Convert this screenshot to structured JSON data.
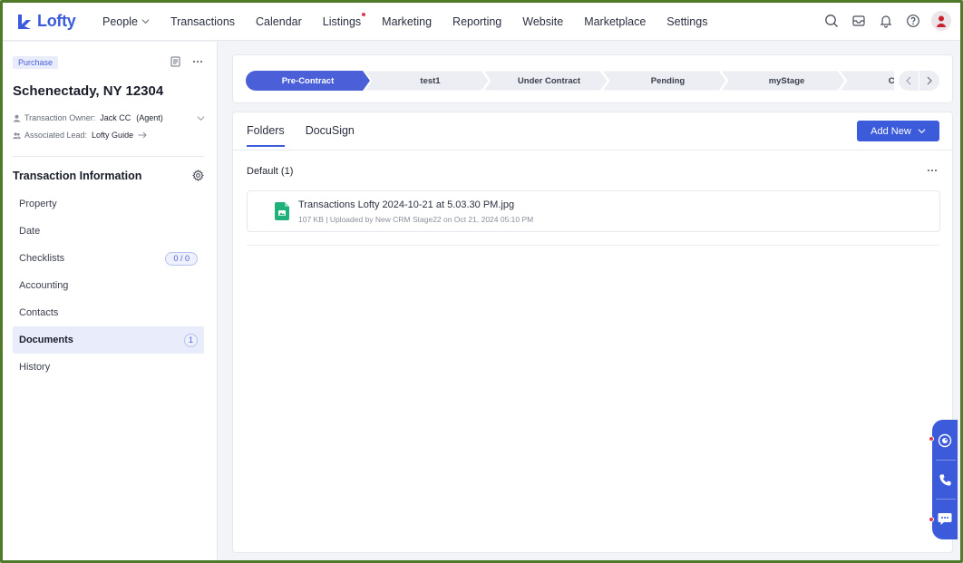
{
  "app": {
    "brand": "Lofty",
    "brand_color": "#3b5bdb"
  },
  "nav": {
    "items": [
      {
        "label": "People",
        "has_dropdown": true
      },
      {
        "label": "Transactions"
      },
      {
        "label": "Calendar"
      },
      {
        "label": "Listings",
        "has_dot": true
      },
      {
        "label": "Marketing"
      },
      {
        "label": "Reporting"
      },
      {
        "label": "Website"
      },
      {
        "label": "Marketplace"
      },
      {
        "label": "Settings"
      }
    ],
    "right_icons": [
      "search-icon",
      "inbox-icon",
      "bell-icon",
      "help-icon",
      "avatar"
    ]
  },
  "transaction": {
    "type_badge": "Purchase",
    "address": "Schenectady, NY 12304",
    "owner_label": "Transaction Owner:",
    "owner_name": "Jack CC",
    "owner_role": "(Agent)",
    "lead_label": "Associated Lead:",
    "lead_name": "Lofty Guide"
  },
  "sidebar": {
    "section_title": "Transaction Information",
    "items": [
      {
        "label": "Property"
      },
      {
        "label": "Date"
      },
      {
        "label": "Checklists",
        "badge": "0 / 0"
      },
      {
        "label": "Accounting"
      },
      {
        "label": "Contacts"
      },
      {
        "label": "Documents",
        "badge": "1",
        "active": true
      },
      {
        "label": "History"
      }
    ]
  },
  "stages": {
    "items": [
      "Pre-Contract",
      "test1",
      "Under Contract",
      "Pending",
      "myStage",
      "Closed/("
    ],
    "current_index": 0,
    "current_color": "#4a5fd8",
    "default_color": "#eceef3"
  },
  "documents": {
    "tabs": [
      {
        "label": "Folders",
        "active": true
      },
      {
        "label": "DocuSign"
      }
    ],
    "add_button": "Add New",
    "folder": {
      "title": "Default (1)"
    },
    "files": [
      {
        "name": "Transactions Lofty 2024-10-21 at 5.03.30 PM.jpg",
        "meta": "107 KB | Uploaded by New CRM Stage22 on Oct 21, 2024 05:10 PM",
        "icon": "image-file-icon",
        "icon_color": "#20b07a"
      }
    ]
  },
  "widget": {
    "buttons": [
      "assistant-icon",
      "phone-icon",
      "chat-icon"
    ]
  }
}
